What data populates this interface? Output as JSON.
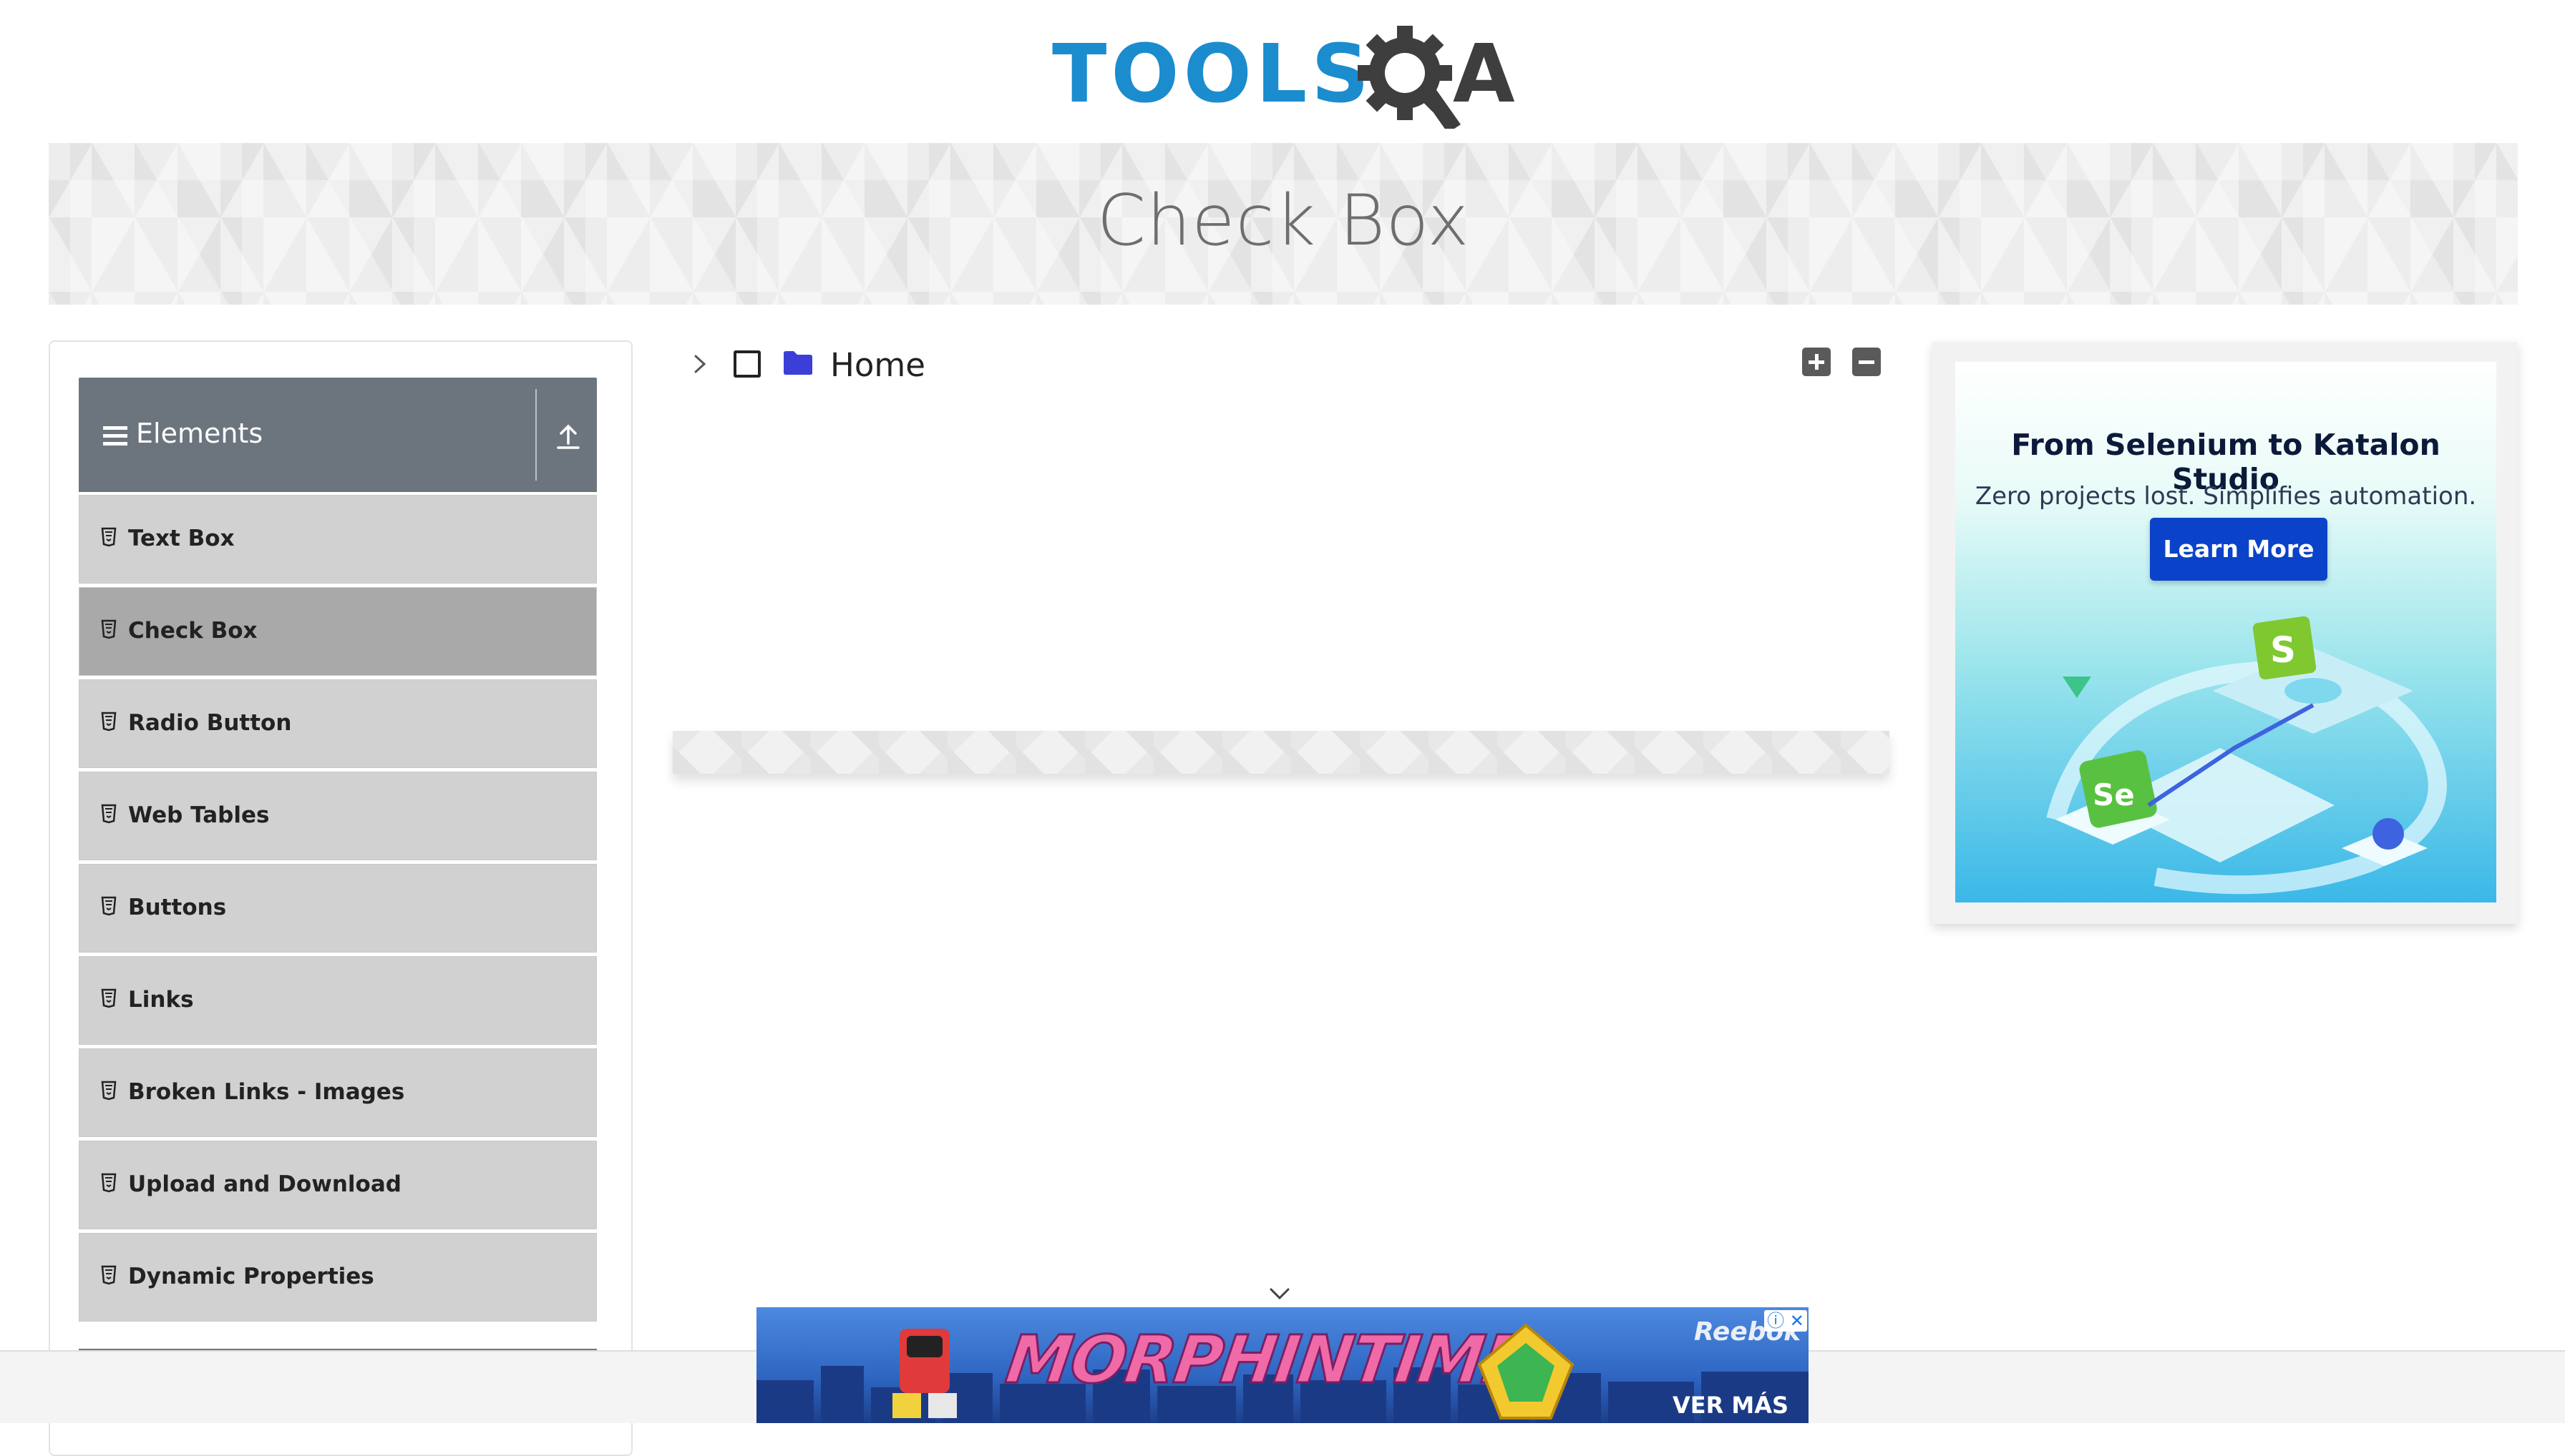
{
  "logo": {
    "text_tools": "TOOLS",
    "text_a": "A"
  },
  "banner": {
    "title": "Check Box"
  },
  "sidebar": {
    "group_title": "Elements",
    "items": [
      {
        "label": "Text Box",
        "active": false
      },
      {
        "label": "Check Box",
        "active": true
      },
      {
        "label": "Radio Button",
        "active": false
      },
      {
        "label": "Web Tables",
        "active": false
      },
      {
        "label": "Buttons",
        "active": false
      },
      {
        "label": "Links",
        "active": false
      },
      {
        "label": "Broken Links - Images",
        "active": false
      },
      {
        "label": "Upload and Download",
        "active": false
      },
      {
        "label": "Dynamic Properties",
        "active": false
      }
    ]
  },
  "tree": {
    "root_label": "Home",
    "checked": false,
    "expanded": false
  },
  "ad_right": {
    "title": "From Selenium to Katalon Studio",
    "subtitle": "Zero projects lost. Simplifies automation.",
    "button": "Learn More",
    "badge_s": "S",
    "badge_se": "Se"
  },
  "ad_bottom": {
    "headline": "MORPHINTIME",
    "brand": "Reebok",
    "cta": "VER MÁS",
    "info": "ⓘ ✕"
  },
  "colors": {
    "brand_blue": "#1b8cce",
    "menu_header": "#6c757d",
    "menu_item": "#d1d1d1",
    "menu_item_active": "#a9a9a9",
    "ad_button": "#0a43c9",
    "folder": "#3b3fd8"
  },
  "icons": {
    "menu": "hamburger-icon",
    "collapse_group": "arrow-up-icon",
    "item": "html5-icon",
    "tree_toggle": "chevron-right-icon",
    "tree_node": "folder-icon",
    "expand_all": "plus-square-icon",
    "collapse_all": "minus-square-icon"
  }
}
